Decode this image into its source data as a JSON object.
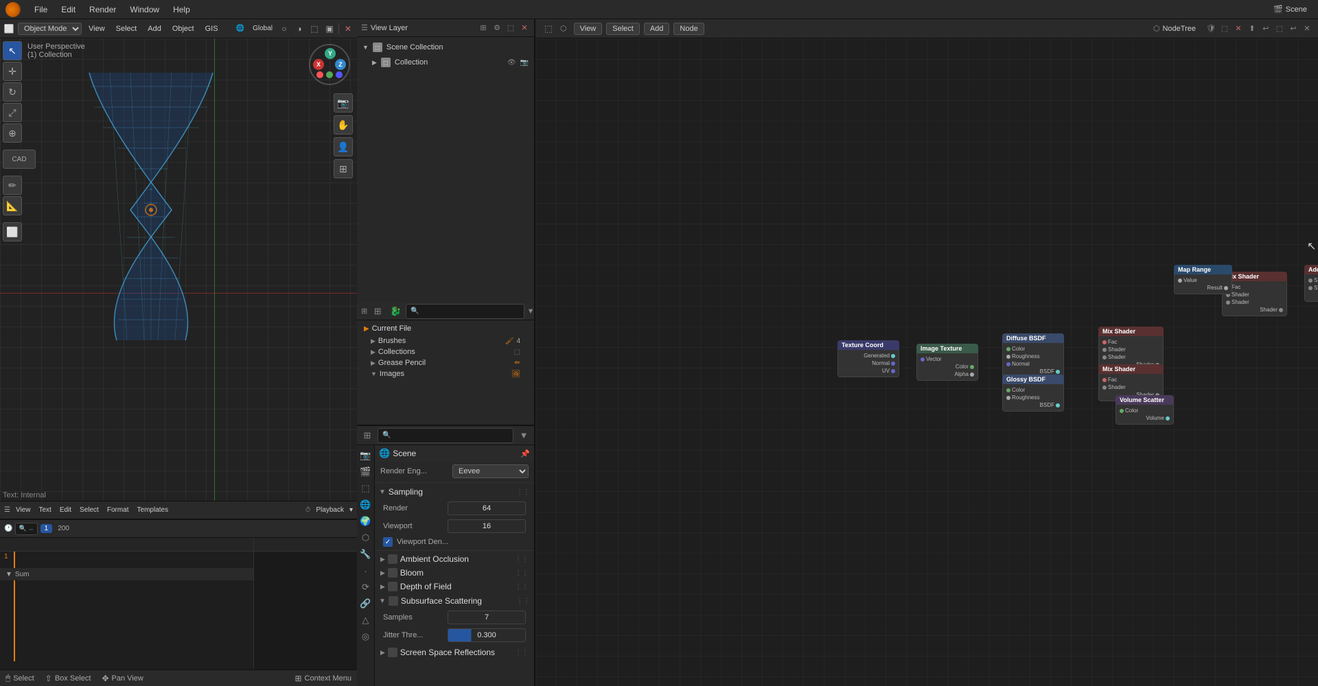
{
  "app": {
    "title": "Blender",
    "menus": [
      "File",
      "Edit",
      "Render",
      "Window",
      "Help"
    ]
  },
  "viewport": {
    "mode": "Object Mode",
    "perspective": "User Perspective",
    "collection": "(1) Collection",
    "menus": [
      "View",
      "Select",
      "Add",
      "Object",
      "GIS"
    ],
    "transform_mode": "Global"
  },
  "outliner": {
    "title": "View Layer",
    "scene_collection": "Scene Collection",
    "collection": "Collection"
  },
  "properties": {
    "scene_label": "Scene",
    "render_engine_label": "Render Eng...",
    "render_engine": "Eevee",
    "sampling": {
      "label": "Sampling",
      "render_label": "Render",
      "render_value": "64",
      "viewport_label": "Viewport",
      "viewport_value": "16",
      "viewport_denoise_label": "Viewport Den...",
      "viewport_denoise_checked": true
    },
    "ambient_occlusion": {
      "label": "Ambient Occlusion"
    },
    "bloom": {
      "label": "Bloom"
    },
    "depth_of_field": {
      "label": "Depth of Field"
    },
    "subsurface_scattering": {
      "label": "Subsurface Scattering",
      "samples_label": "Samples",
      "samples_value": "7",
      "jitter_label": "Jitter Thre...",
      "jitter_value": "0.300"
    },
    "screen_space_reflections": {
      "label": "Screen Space Reflections"
    }
  },
  "data_browser": {
    "current_file": "Current File",
    "brushes_label": "Brushes",
    "brushes_count": "4",
    "collections_label": "Collections",
    "grease_pencil_label": "Grease Pencil",
    "images_label": "Images"
  },
  "node_editor": {
    "menus": [
      "View",
      "Select",
      "Add",
      "Node"
    ],
    "title": "NodeTree"
  },
  "timeline": {
    "menus": [
      "View",
      "Text",
      "Edit",
      "Select",
      "Format",
      "Templates"
    ],
    "playback_label": "Playback",
    "frame_start": "1",
    "frame_end": "200",
    "summary": "Sum"
  },
  "statusbar": {
    "select_label": "Select",
    "box_select_label": "Box Select",
    "pan_label": "Pan View",
    "context_menu_label": "Context Menu",
    "text_internal": "Text: Internal"
  },
  "gizmo": {
    "x_label": "X",
    "y_label": "Y",
    "z_label": "Z"
  }
}
